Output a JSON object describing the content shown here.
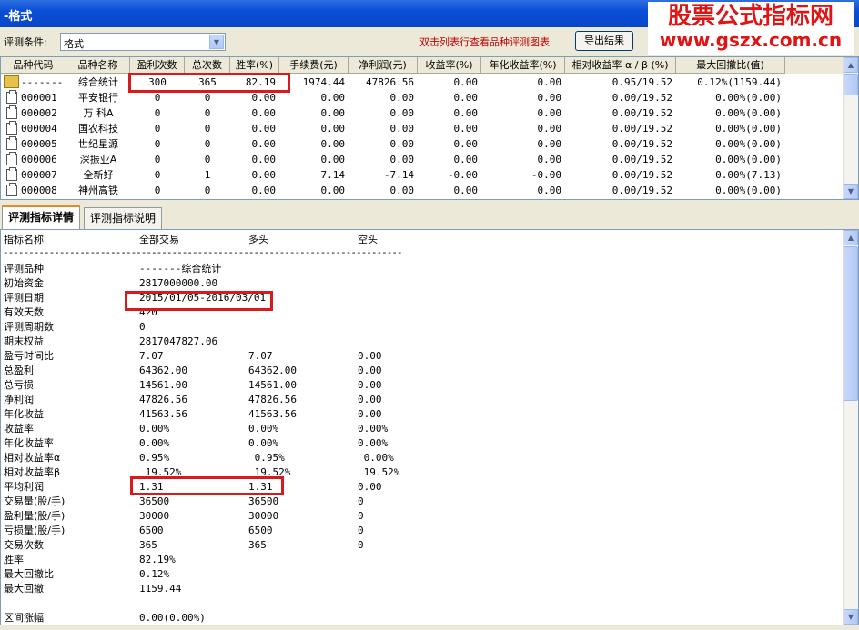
{
  "window": {
    "title": "-格式"
  },
  "watermark": {
    "line1": "股票公式指标网",
    "line2": "www.gszx.com.cn"
  },
  "conditions": {
    "label": "评测条件:",
    "selected": "格式",
    "hint": "双击列表行查看品种评测图表",
    "export_label": "导出结果"
  },
  "table": {
    "columns": [
      "品种代码",
      "品种名称",
      "盈利次数",
      "总次数",
      "胜率(%)",
      "手续费(元)",
      "净利润(元)",
      "收益率(%)",
      "年化收益率(%)",
      "相对收益率 α / β (%)",
      "最大回撤比(值)"
    ],
    "rows": [
      [
        "-------",
        "综合统计",
        "300",
        "365",
        "82.19",
        "1974.44",
        "47826.56",
        "0.00",
        "0.00",
        "0.95/19.52",
        "0.12%(1159.44)"
      ],
      [
        "000001",
        "平安银行",
        "0",
        "0",
        "0.00",
        "0.00",
        "0.00",
        "0.00",
        "0.00",
        "0.00/19.52",
        "0.00%(0.00)"
      ],
      [
        "000002",
        "万  科A",
        "0",
        "0",
        "0.00",
        "0.00",
        "0.00",
        "0.00",
        "0.00",
        "0.00/19.52",
        "0.00%(0.00)"
      ],
      [
        "000004",
        "国农科技",
        "0",
        "0",
        "0.00",
        "0.00",
        "0.00",
        "0.00",
        "0.00",
        "0.00/19.52",
        "0.00%(0.00)"
      ],
      [
        "000005",
        "世纪星源",
        "0",
        "0",
        "0.00",
        "0.00",
        "0.00",
        "0.00",
        "0.00",
        "0.00/19.52",
        "0.00%(0.00)"
      ],
      [
        "000006",
        "深振业A",
        "0",
        "0",
        "0.00",
        "0.00",
        "0.00",
        "0.00",
        "0.00",
        "0.00/19.52",
        "0.00%(0.00)"
      ],
      [
        "000007",
        "全新好",
        "0",
        "1",
        "0.00",
        "7.14",
        "-7.14",
        "-0.00",
        "-0.00",
        "0.00/19.52",
        "0.00%(7.13)"
      ],
      [
        "000008",
        "神州高铁",
        "0",
        "0",
        "0.00",
        "0.00",
        "0.00",
        "0.00",
        "0.00",
        "0.00/19.52",
        "0.00%(0.00)"
      ]
    ]
  },
  "tabs": [
    "评测指标详情",
    "评测指标说明"
  ],
  "detail": {
    "headers": [
      "指标名称",
      "全部交易",
      "多头",
      "空头"
    ],
    "separator": "---------------------------------------------------------------------------------------------------------------------------",
    "rows": [
      [
        "评测品种",
        "-------综合统计",
        "",
        ""
      ],
      [
        "初始资金",
        "2817000000.00",
        "",
        ""
      ],
      [
        "评测日期",
        "2015/01/05-2016/03/01",
        "",
        ""
      ],
      [
        "有效天数",
        "420",
        "",
        ""
      ],
      [
        "评测周期数",
        "0",
        "",
        ""
      ],
      [
        "期末权益",
        "2817047827.06",
        "",
        ""
      ],
      [
        "盈亏时间比",
        "7.07",
        "7.07",
        "0.00"
      ],
      [
        "总盈利",
        "64362.00",
        "64362.00",
        "0.00"
      ],
      [
        "总亏损",
        "14561.00",
        "14561.00",
        "0.00"
      ],
      [
        "净利润",
        "47826.56",
        "47826.56",
        "0.00"
      ],
      [
        "年化收益",
        "41563.56",
        "41563.56",
        "0.00"
      ],
      [
        "收益率",
        "0.00%",
        "0.00%",
        "0.00%"
      ],
      [
        "年化收益率",
        "0.00%",
        "0.00%",
        "0.00%"
      ],
      [
        "相对收益率α",
        "0.95%",
        " 0.95%",
        " 0.00%"
      ],
      [
        "相对收益率β",
        " 19.52%",
        " 19.52%",
        " 19.52%"
      ],
      [
        "平均利润",
        "1.31",
        "1.31",
        "0.00"
      ],
      [
        "交易量(股/手)",
        "36500",
        "36500",
        "0"
      ],
      [
        "盈利量(股/手)",
        "30000",
        "30000",
        "0"
      ],
      [
        "亏损量(股/手)",
        "6500",
        "6500",
        "0"
      ],
      [
        "交易次数",
        "365",
        "365",
        "0"
      ],
      [
        "胜率",
        "82.19%",
        "",
        ""
      ],
      [
        "最大回撤比",
        "0.12%",
        "",
        ""
      ],
      [
        "最大回撤",
        "1159.44",
        "",
        ""
      ],
      [
        "",
        "",
        "",
        ""
      ],
      [
        "区间涨幅",
        "0.00(0.00%)",
        "",
        ""
      ]
    ]
  },
  "colors": {
    "title_bar": "#0a4ed6",
    "highlight_box": "#d91a1a",
    "hint_text": "#c00000",
    "watermark_text": "#e01414"
  }
}
